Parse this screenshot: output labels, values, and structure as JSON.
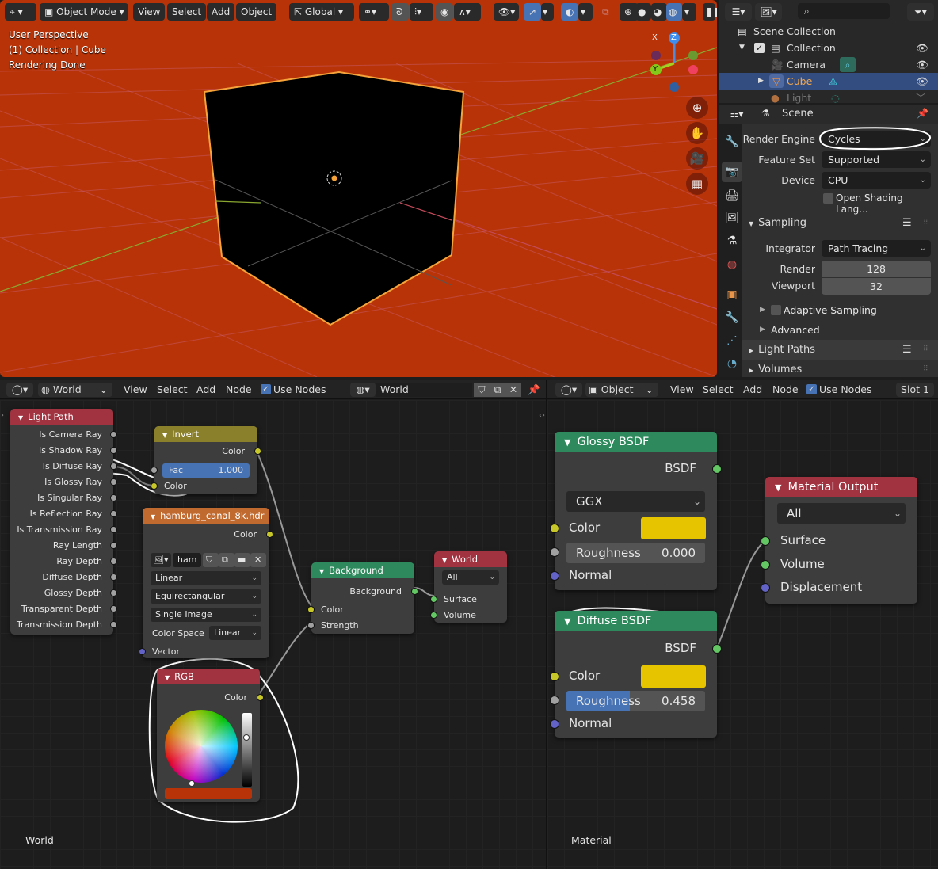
{
  "viewport": {
    "mode": "Object Mode",
    "menus": [
      "View",
      "Select",
      "Add",
      "Object"
    ],
    "transform_orientation": "Global",
    "info": [
      "User Perspective",
      "(1) Collection | Cube",
      "Rendering Done"
    ],
    "gizmo": {
      "x": "X",
      "y": "Y",
      "z": "Z"
    },
    "nav_icons": [
      "zoom-in-icon",
      "hand-pan-icon",
      "camera-icon",
      "grid-ortho-icon"
    ],
    "colors": {
      "background": "#b83408",
      "selection_outline": "#f5a33a"
    }
  },
  "outliner": {
    "search_placeholder": "",
    "items": [
      {
        "label": "Scene Collection",
        "icon": "collection-box-icon",
        "depth": 0
      },
      {
        "label": "Collection",
        "icon": "collection-box-icon",
        "depth": 1,
        "checked": true,
        "visible": true
      },
      {
        "label": "Camera",
        "icon": "camera-object-icon",
        "depth": 2,
        "visible": true
      },
      {
        "label": "Cube",
        "icon": "mesh-object-icon",
        "depth": 2,
        "visible": true,
        "selected": true
      },
      {
        "label": "Light",
        "icon": "light-object-icon",
        "depth": 2,
        "visible": true
      }
    ]
  },
  "properties": {
    "context": "Scene",
    "fields": {
      "render_engine": {
        "label": "Render Engine",
        "value": "Cycles"
      },
      "feature_set": {
        "label": "Feature Set",
        "value": "Supported"
      },
      "device": {
        "label": "Device",
        "value": "CPU"
      },
      "osl": {
        "label": "Open Shading Lang...",
        "checked": false
      }
    },
    "sampling": {
      "title": "Sampling",
      "integrator": {
        "label": "Integrator",
        "value": "Path Tracing"
      },
      "render": {
        "label": "Render",
        "value": "128"
      },
      "viewport": {
        "label": "Viewport",
        "value": "32"
      },
      "adaptive": {
        "label": "Adaptive Sampling",
        "checked": false
      },
      "advanced": "Advanced"
    },
    "sections": [
      "Light Paths",
      "Volumes"
    ]
  },
  "world_editor": {
    "type": "World",
    "menus": [
      "View",
      "Select",
      "Add",
      "Node"
    ],
    "use_nodes_label": "Use Nodes",
    "use_nodes": true,
    "datablock": "World",
    "footer_label": "World",
    "nodes": {
      "light_path": {
        "title": "Light Path",
        "outputs": [
          "Is Camera Ray",
          "Is Shadow Ray",
          "Is Diffuse Ray",
          "Is Glossy Ray",
          "Is Singular Ray",
          "Is Reflection Ray",
          "Is Transmission Ray",
          "Ray Length",
          "Ray Depth",
          "Diffuse Depth",
          "Glossy Depth",
          "Transparent Depth",
          "Transmission Depth"
        ]
      },
      "invert": {
        "title": "Invert",
        "output": "Color",
        "fac_label": "Fac",
        "fac_value": "1.000",
        "fac": 1.0,
        "color_input": "Color"
      },
      "image": {
        "title": "hamburg_canal_8k.hdr",
        "output": "Color",
        "image_name": "ham",
        "interpolation": "Linear",
        "projection": "Equirectangular",
        "source": "Single Image",
        "color_space_label": "Color Space",
        "color_space": "Linear",
        "input": "Vector"
      },
      "rgb": {
        "title": "RGB",
        "output": "Color",
        "color": "#b83408",
        "value_fraction": 0.7
      },
      "background": {
        "title": "Background",
        "output": "Background",
        "inputs": [
          "Color",
          "Strength"
        ]
      },
      "world_output": {
        "title": "World Output",
        "target": "All",
        "inputs": [
          "Surface",
          "Volume"
        ]
      }
    }
  },
  "material_editor": {
    "type": "Object",
    "menus": [
      "View",
      "Select",
      "Add",
      "Node"
    ],
    "use_nodes_label": "Use Nodes",
    "use_nodes": true,
    "slot": "Slot 1",
    "footer_label": "Material",
    "nodes": {
      "glossy": {
        "title": "Glossy BSDF",
        "output": "BSDF",
        "distribution": "GGX",
        "color_label": "Color",
        "color": "#e6c500",
        "roughness_label": "Roughness",
        "roughness": "0.000",
        "normal_label": "Normal"
      },
      "diffuse": {
        "title": "Diffuse BSDF",
        "output": "BSDF",
        "color_label": "Color",
        "color": "#e6c500",
        "roughness_label": "Roughness",
        "roughness": "0.458",
        "roughness_fraction": 0.458,
        "normal_label": "Normal"
      },
      "material_output": {
        "title": "Material Output",
        "target": "All",
        "inputs": [
          "Surface",
          "Volume",
          "Displacement"
        ]
      }
    }
  }
}
